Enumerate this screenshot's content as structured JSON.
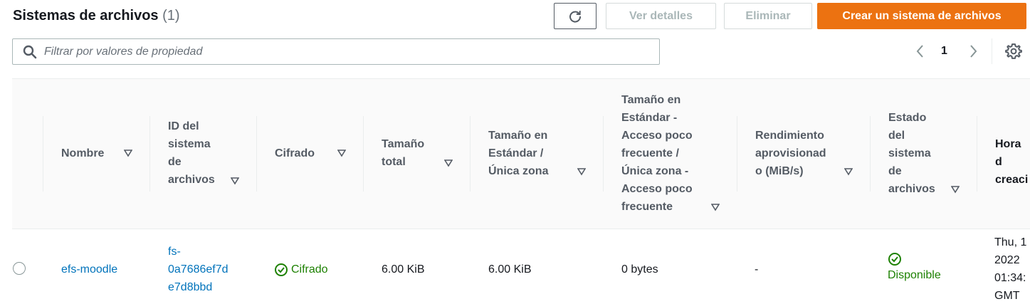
{
  "header": {
    "title": "Sistemas de archivos",
    "count": "(1)",
    "buttons": {
      "details": "Ver detalles",
      "delete": "Eliminar",
      "create": "Crear un sistema de archivos"
    }
  },
  "filter": {
    "placeholder": "Filtrar por valores de propiedad"
  },
  "pagination": {
    "current_page": "1"
  },
  "columns": [
    "Nombre",
    "ID del\nsistema\nde\narchivos",
    "Cifrado",
    "Tamaño\ntotal",
    "Tamaño en\nEstándar /\nÚnica zona",
    "Tamaño en\nEstándar -\nAcceso poco\nfrecuente /\nÚnica zona -\nAcceso poco\nfrecuente",
    "Rendimiento\naprovisionad\no (MiB/s)",
    "Estado\ndel\nsistema\nde\narchivos",
    "Hora d\ncreaci"
  ],
  "rows": [
    {
      "name": "efs-moodle",
      "id": "fs-\n0a7686ef7d\ne7d8bbd",
      "encryption": "Cifrado",
      "total_size": "6.00 KiB",
      "standard_size": "6.00 KiB",
      "ia_size": "0 bytes",
      "throughput": "-",
      "state": "Disponible",
      "created": "Thu, 1\n2022\n01:34:\nGMT"
    }
  ],
  "colors": {
    "accent": "#ec7211",
    "link": "#0073bb",
    "success": "#1d8102"
  }
}
